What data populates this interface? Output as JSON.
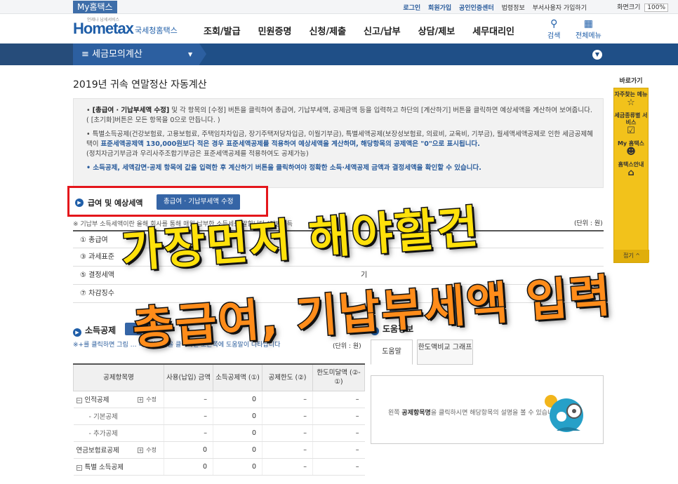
{
  "topbar": {
    "my_hometax": "My홈택스",
    "links": [
      "로그인",
      "회원가입",
      "공인인증센터",
      "법령정보",
      "부서사용자 가입하기"
    ],
    "screen_size_label": "화면크기",
    "zoom": "100%"
  },
  "header": {
    "logo_main": "Hometax",
    "logo_sub": "국세청홈택스",
    "logo_tagline": "언제나 납세서비스",
    "nav": [
      "조회/발급",
      "민원증명",
      "신청/제출",
      "신고/납부",
      "상담/제보",
      "세무대리인"
    ],
    "search_label": "검색",
    "menu_label": "전체메뉴"
  },
  "subnav": {
    "current": "세금모의계산"
  },
  "page": {
    "title": "2019년 귀속 연말정산 자동계산",
    "info": [
      {
        "prefix": "[총급여 · 기납부세액 수정]",
        "text": " 및 각 항목의 [수정] 버튼을 클릭하여 총급여, 기납부세액, 공제금액 등을 입력하고 하단의 [계산하기] 버튼을 클릭하면 예상세액을 계산하여 보여줍니다.( [초기화]버튼은 모든 항목을 0으로 만듭니다. )"
      },
      {
        "prefix": "",
        "text": "특별소득공제(건강보험료, 고용보험료, 주택임차차입금, 장기주택저당차입금, 이월기부금), 특별세액공제(보장성보험료, 의료비, 교육비, 기부금), 월세액세액공제로 인한 세금공제혜택이 ",
        "bold": "표준세액공제액 130,000원보다 적은 경우 표준세액공제를 적용하여 예상세액을 계산하며, 해당항목의 공제액은 \"0\"으로 표시됩니다.",
        "tail": "(정치자금기부금과 우리사주조합기부금은 표준세액공제를 적용하여도 공제가능)"
      },
      {
        "prefix": "",
        "text": "소득공제, 세액감면·공제 항목에 값을 입력한 후 계산하기 버튼을 클릭하여야 정확한 소득·세액공제 금액과 결정세액을 확인할 수 있습니다."
      }
    ]
  },
  "salary_section": {
    "heading": "급여 및 예상세액",
    "edit_button": "총급여 · 기납부세액 수정",
    "note": "※ 기납부 소득세액이란 올해 회사를 통해 매월 납부한 소득세를 말합니다.(지방소득",
    "unit": "(단위 : 원)",
    "rows": [
      {
        "label": "① 총급여",
        "value": ""
      },
      {
        "label": "③ 과세표준",
        "value": ""
      },
      {
        "label": "⑤ 결정세액",
        "mid": "기",
        "value": ""
      },
      {
        "label": "⑦ 차감징수",
        "value": "0"
      }
    ]
  },
  "deduction_section": {
    "heading": "소득공제",
    "note": "※+를 클릭하면 그림 … 해당항목명을 클릭하면 오른쪽에 도움말이 나타납니다",
    "unit": "(단위 : 원)",
    "columns": [
      "공제항목명",
      "사용(납입) 금액",
      "소득공제액 (①)",
      "공제한도 (②)",
      "한도미달액 (②-①)"
    ],
    "rows": [
      {
        "name": "인적공제",
        "toggle": "−",
        "edit": "수정",
        "amount": "–",
        "deduction": "0",
        "limit": "–",
        "shortfall": "–"
      },
      {
        "name": "- 기본공제",
        "toggle": "",
        "edit": "",
        "amount": "–",
        "deduction": "0",
        "limit": "–",
        "shortfall": "–"
      },
      {
        "name": "- 추가공제",
        "toggle": "",
        "edit": "",
        "amount": "–",
        "deduction": "0",
        "limit": "–",
        "shortfall": "–"
      },
      {
        "name": "연금보험료공제",
        "toggle": "",
        "edit": "수정",
        "amount": "0",
        "deduction": "0",
        "limit": "–",
        "shortfall": "–"
      },
      {
        "name": "특별 소득공제",
        "toggle": "−",
        "edit": "",
        "amount": "0",
        "deduction": "0",
        "limit": "–",
        "shortfall": "–"
      }
    ]
  },
  "help": {
    "heading": "도움정보",
    "tabs": [
      "도움말",
      "한도액비교 그래프"
    ],
    "text_bold": "공제항목명",
    "text_pre": "왼쪽 ",
    "text_post": "을 클릭하시면 해당항목의 설명을 볼 수 있습니다."
  },
  "quick_menu": {
    "title": "바로가기",
    "items": [
      {
        "label": "자주찾는 메뉴",
        "icon": "star-icon"
      },
      {
        "label": "세금종류별 서비스",
        "icon": "checkbox-icon"
      },
      {
        "label": "My 홈택스",
        "icon": "person-icon"
      },
      {
        "label": "홈택스안내",
        "icon": "home-icon"
      }
    ],
    "close": "접기 ^"
  },
  "overlay": {
    "line1": "가장먼저 해야할건",
    "line2": "총급여, 기납부세액 입력"
  }
}
